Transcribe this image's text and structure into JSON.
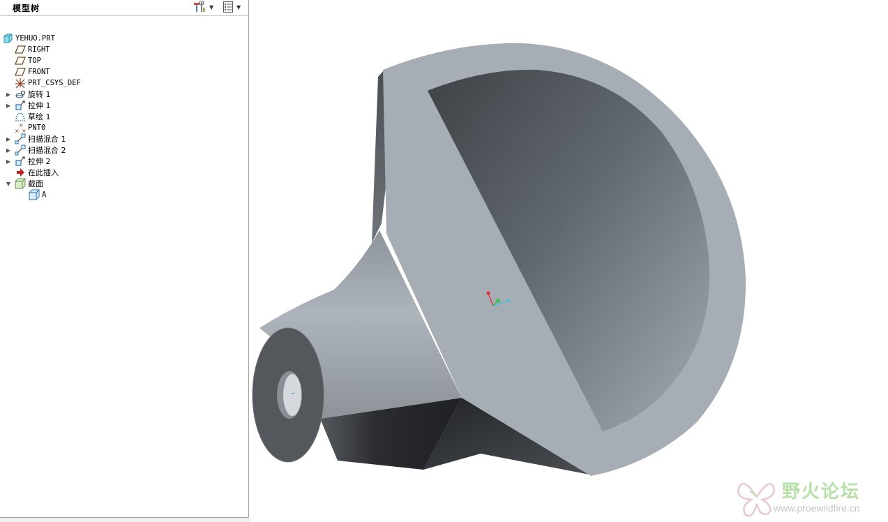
{
  "model_tree": {
    "title": "模型树",
    "items": [
      {
        "label": "YEHUO.PRT",
        "icon": "part-icon"
      },
      {
        "label": "RIGHT",
        "icon": "datum-plane-icon"
      },
      {
        "label": "TOP",
        "icon": "datum-plane-icon"
      },
      {
        "label": "FRONT",
        "icon": "datum-plane-icon"
      },
      {
        "label": "PRT_CSYS_DEF",
        "icon": "csys-icon"
      },
      {
        "label": "旋转 1",
        "icon": "revolve-icon"
      },
      {
        "label": "拉伸 1",
        "icon": "extrude-icon"
      },
      {
        "label": "草绘 1",
        "icon": "sketch-icon"
      },
      {
        "label": "PNT0",
        "icon": "datum-point-icon"
      },
      {
        "label": "扫描混合 1",
        "icon": "swept-blend-icon"
      },
      {
        "label": "扫描混合 2",
        "icon": "swept-blend-icon"
      },
      {
        "label": "拉伸 2",
        "icon": "extrude-icon"
      },
      {
        "label": "在此插入",
        "icon": "insert-here-icon"
      },
      {
        "label": "截面",
        "icon": "sections-folder-icon"
      },
      {
        "label": "A",
        "icon": "section-icon"
      }
    ]
  },
  "watermark": {
    "brand": "野火论坛",
    "url": "www.proewildfire.cn"
  },
  "colors": {
    "panel_border": "#a0a0a0",
    "model_face_light": "#a8aeb5",
    "model_face_dark": "#2a2c2f",
    "watermark_green": "#b7e0a8"
  }
}
